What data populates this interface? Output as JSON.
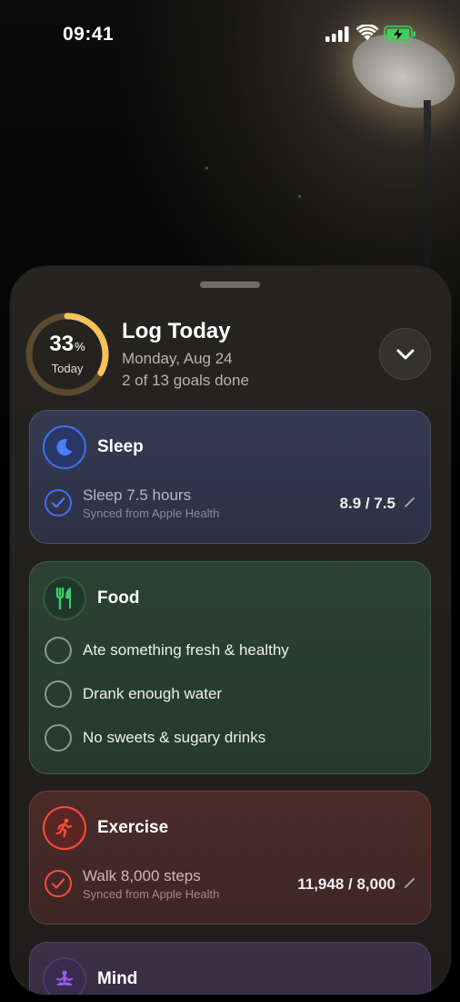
{
  "status_bar": {
    "time": "09:41"
  },
  "sheet": {
    "progress": {
      "percent_value": 33,
      "percent": "33",
      "unit": "%",
      "label": "Today"
    },
    "title": "Log Today",
    "date": "Monday, Aug 24",
    "goals_summary": "2 of 13 goals done",
    "cards": {
      "sleep": {
        "title": "Sleep",
        "color": "#3e6ff0",
        "goal": {
          "name": "Sleep 7.5 hours",
          "source": "Synced from Apple Health",
          "value": "8.9 / 7.5",
          "done": true
        }
      },
      "food": {
        "title": "Food",
        "color": "#3ecf6a",
        "items": [
          {
            "label": "Ate something fresh & healthy",
            "done": false
          },
          {
            "label": "Drank enough water",
            "done": false
          },
          {
            "label": "No sweets & sugary drinks",
            "done": false
          }
        ]
      },
      "exercise": {
        "title": "Exercise",
        "color": "#ff4a3c",
        "goal": {
          "name": "Walk 8,000 steps",
          "source": "Synced from Apple Health",
          "value": "11,948 / 8,000",
          "done": true
        }
      },
      "mind": {
        "title": "Mind",
        "color": "#9b5cf0"
      }
    }
  },
  "icons": [
    "cellular-signal-icon",
    "wifi-icon",
    "battery-charging-icon",
    "chevron-down-icon",
    "moon-icon",
    "fork-knife-icon",
    "running-icon",
    "meditation-icon",
    "checkmark-icon",
    "pencil-icon"
  ]
}
